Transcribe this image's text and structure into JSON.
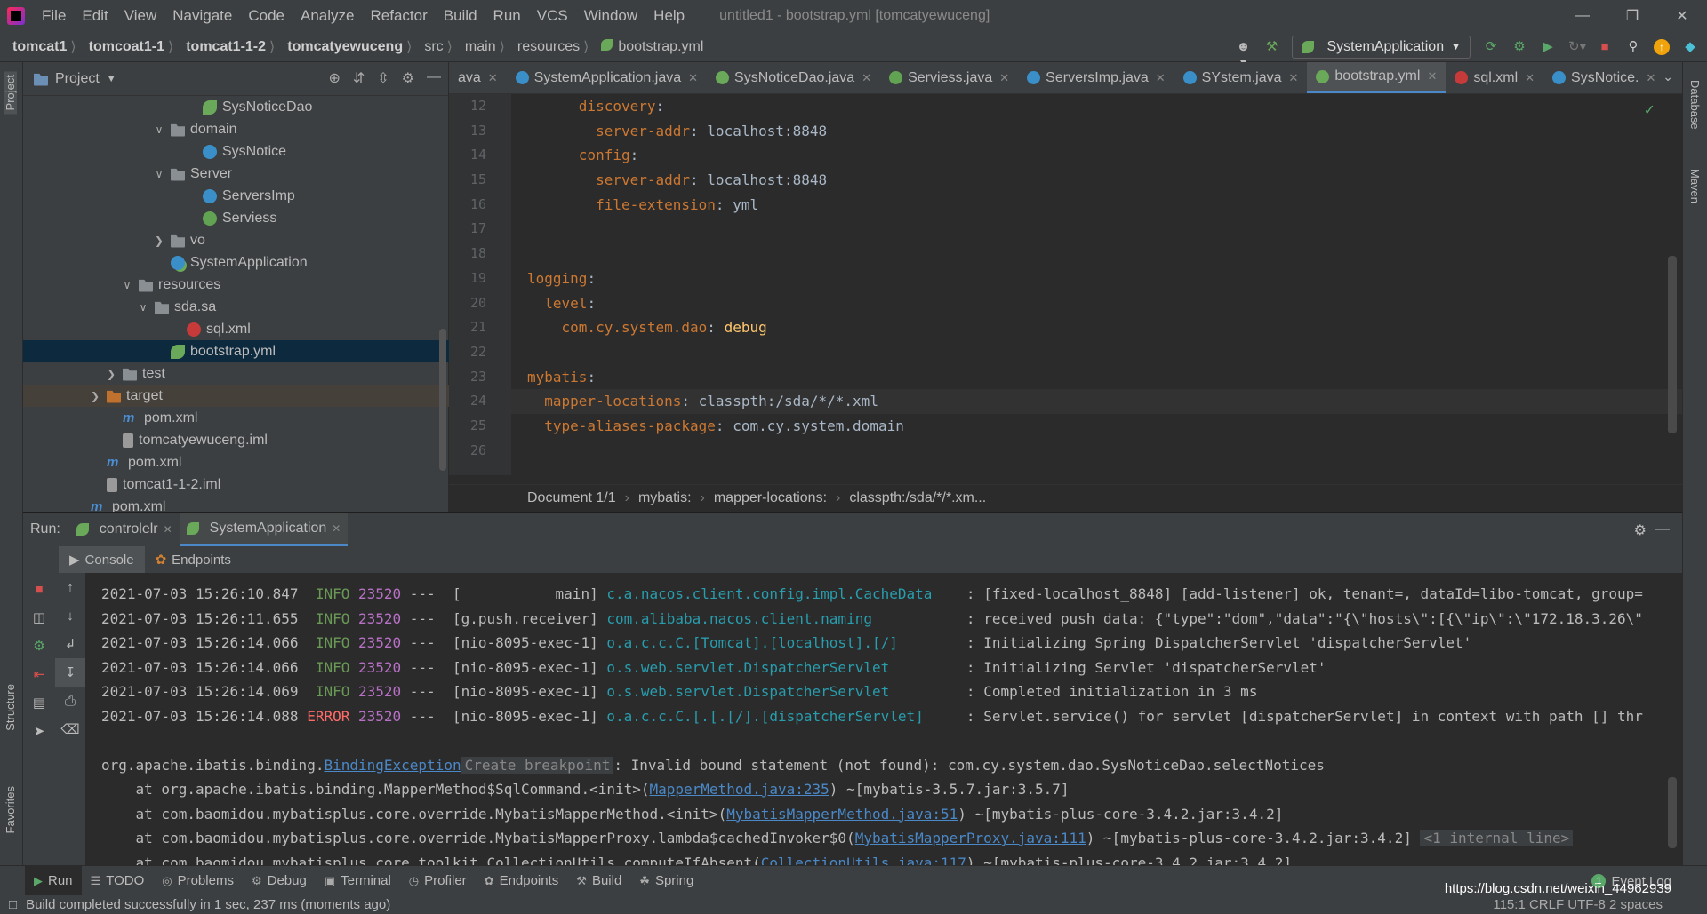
{
  "menubar": {
    "items": [
      "File",
      "Edit",
      "View",
      "Navigate",
      "Code",
      "Analyze",
      "Refactor",
      "Build",
      "Run",
      "VCS",
      "Window",
      "Help"
    ],
    "window_title": "untitled1 - bootstrap.yml [tomcatyewuceng]"
  },
  "breadcrumbs": [
    "tomcat1",
    "tomcoat1-1",
    "tomcat1-1-2",
    "tomcatyewuceng",
    "src",
    "main",
    "resources",
    "bootstrap.yml"
  ],
  "run_config": "SystemApplication",
  "project_panel": {
    "title": "Project",
    "tree": [
      {
        "label": "SysNoticeDao",
        "icon": "spring-icon",
        "indent": 10,
        "arrow": ""
      },
      {
        "label": "domain",
        "icon": "folder-icon",
        "indent": 8,
        "arrow": "v"
      },
      {
        "label": "SysNotice",
        "icon": "class-icon",
        "indent": 10,
        "arrow": ""
      },
      {
        "label": "Server",
        "icon": "folder-icon",
        "indent": 8,
        "arrow": "v"
      },
      {
        "label": "ServersImp",
        "icon": "class-icon",
        "indent": 10,
        "arrow": ""
      },
      {
        "label": "Serviess",
        "icon": "interface-icon",
        "indent": 10,
        "arrow": ""
      },
      {
        "label": "vo",
        "icon": "folder-icon",
        "indent": 8,
        "arrow": ">"
      },
      {
        "label": "SystemApplication",
        "icon": "spring-app-icon",
        "indent": 8,
        "arrow": ""
      },
      {
        "label": "resources",
        "icon": "folder-icon",
        "indent": 6,
        "arrow": "v"
      },
      {
        "label": "sda.sa",
        "icon": "folder-icon",
        "indent": 7,
        "arrow": "v"
      },
      {
        "label": "sql.xml",
        "icon": "xml-icon",
        "indent": 9,
        "arrow": ""
      },
      {
        "label": "bootstrap.yml",
        "icon": "spring-icon",
        "indent": 8,
        "arrow": "",
        "selected": true
      },
      {
        "label": "test",
        "icon": "folder-icon",
        "indent": 5,
        "arrow": ">"
      },
      {
        "label": "target",
        "icon": "folder-orange-icon",
        "indent": 4,
        "arrow": ">",
        "target": true
      },
      {
        "label": "pom.xml",
        "icon": "maven-icon",
        "indent": 5,
        "arrow": ""
      },
      {
        "label": "tomcatyewuceng.iml",
        "icon": "iml-icon",
        "indent": 5,
        "arrow": ""
      },
      {
        "label": "pom.xml",
        "icon": "maven-icon",
        "indent": 4,
        "arrow": ""
      },
      {
        "label": "tomcat1-1-2.iml",
        "icon": "iml-icon",
        "indent": 4,
        "arrow": ""
      },
      {
        "label": "pom.xml",
        "icon": "maven-icon",
        "indent": 3,
        "arrow": ""
      }
    ]
  },
  "editor_tabs": [
    {
      "label": "ava",
      "color": "#3a8fc9",
      "active": false,
      "partial": true
    },
    {
      "label": "SystemApplication.java",
      "color": "#3a8fc9",
      "active": false
    },
    {
      "label": "SysNoticeDao.java",
      "color": "#6aa85a",
      "active": false
    },
    {
      "label": "Serviess.java",
      "color": "#61a352",
      "active": false
    },
    {
      "label": "ServersImp.java",
      "color": "#3a8fc9",
      "active": false
    },
    {
      "label": "SYstem.java",
      "color": "#3a8fc9",
      "active": false
    },
    {
      "label": "bootstrap.yml",
      "color": "#6aa85a",
      "active": true
    },
    {
      "label": "sql.xml",
      "color": "#c63a3a",
      "active": false
    },
    {
      "label": "SysNotice.",
      "color": "#3a8fc9",
      "active": false
    }
  ],
  "code": {
    "line_numbers": [
      "12",
      "13",
      "14",
      "15",
      "16",
      "17",
      "18",
      "19",
      "20",
      "21",
      "22",
      "23",
      "24",
      "25",
      "26"
    ],
    "lines": [
      {
        "indent": "      ",
        "key": "discovery",
        "sep": ":",
        "val": ""
      },
      {
        "indent": "        ",
        "key": "server-addr",
        "sep": ": ",
        "val": "localhost:8848"
      },
      {
        "indent": "      ",
        "key": "config",
        "sep": ":",
        "val": ""
      },
      {
        "indent": "        ",
        "key": "server-addr",
        "sep": ": ",
        "val": "localhost:8848"
      },
      {
        "indent": "        ",
        "key": "file-extension",
        "sep": ": ",
        "val": "yml"
      },
      {
        "indent": "",
        "key": "",
        "sep": "",
        "val": ""
      },
      {
        "indent": "",
        "key": "",
        "sep": "",
        "val": ""
      },
      {
        "indent": "",
        "key": "logging",
        "sep": ":",
        "val": ""
      },
      {
        "indent": "  ",
        "key": "level",
        "sep": ":",
        "val": ""
      },
      {
        "indent": "    ",
        "key": "com.cy.system.dao",
        "sep": ": ",
        "val": "debug",
        "valclass": "g"
      },
      {
        "indent": "",
        "key": "",
        "sep": "",
        "val": ""
      },
      {
        "indent": "",
        "key": "mybatis",
        "sep": ":",
        "val": ""
      },
      {
        "indent": "  ",
        "key": "mapper-locations",
        "sep": ": ",
        "val": "classpth:/sda/*/*.xml",
        "current": true
      },
      {
        "indent": "  ",
        "key": "type-aliases-package",
        "sep": ": ",
        "val": "com.cy.system.domain"
      },
      {
        "indent": "",
        "key": "",
        "sep": "",
        "val": ""
      }
    ]
  },
  "editor_status": {
    "doc": "Document 1/1",
    "path": [
      "mybatis:",
      "mapper-locations:",
      "classpth:/sda/*/*.xm..."
    ]
  },
  "run_panel": {
    "label": "Run:",
    "tabs": [
      {
        "label": "controlelr",
        "active": false
      },
      {
        "label": "SystemApplication",
        "active": true
      }
    ],
    "subtabs": [
      "Console",
      "Endpoints"
    ],
    "console_lines": [
      {
        "ts": "2021-07-03 15:26:10.847",
        "lvl": "INFO",
        "pid": "23520",
        "thread": "---  [           main]",
        "cat": "c.a.nacos.client.config.impl.CacheData   ",
        "msg": ": [fixed-localhost_8848] [add-listener] ok, tenant=, dataId=libo-tomcat, group="
      },
      {
        "ts": "2021-07-03 15:26:11.655",
        "lvl": "INFO",
        "pid": "23520",
        "thread": "---  [g.push.receiver]",
        "cat": "com.alibaba.nacos.client.naming          ",
        "msg": ": received push data: {\"type\":\"dom\",\"data\":\"{\\\"hosts\\\":[{\\\"ip\\\":\\\"172.18.3.26\\\""
      },
      {
        "ts": "2021-07-03 15:26:14.066",
        "lvl": "INFO",
        "pid": "23520",
        "thread": "---  [nio-8095-exec-1]",
        "cat": "o.a.c.c.C.[Tomcat].[localhost].[/]       ",
        "msg": ": Initializing Spring DispatcherServlet 'dispatcherServlet'"
      },
      {
        "ts": "2021-07-03 15:26:14.066",
        "lvl": "INFO",
        "pid": "23520",
        "thread": "---  [nio-8095-exec-1]",
        "cat": "o.s.web.servlet.DispatcherServlet        ",
        "msg": ": Initializing Servlet 'dispatcherServlet'"
      },
      {
        "ts": "2021-07-03 15:26:14.069",
        "lvl": "INFO",
        "pid": "23520",
        "thread": "---  [nio-8095-exec-1]",
        "cat": "o.s.web.servlet.DispatcherServlet        ",
        "msg": ": Completed initialization in 3 ms"
      },
      {
        "ts": "2021-07-03 15:26:14.088",
        "lvl": "ERROR",
        "pid": "23520",
        "thread": "---  [nio-8095-exec-1]",
        "cat": "o.a.c.c.C.[.[.[/].[dispatcherServlet]    ",
        "msg": ": Servlet.service() for servlet [dispatcherServlet] in context with path [] thr"
      }
    ],
    "exception": {
      "prefix": "org.apache.ibatis.binding.",
      "link": "BindingException",
      "hint": "Create breakpoint",
      "msg": ": Invalid bound statement (not found): com.cy.system.dao.SysNoticeDao.selectNotices"
    },
    "stack": [
      {
        "pre": "    at org.apache.ibatis.binding.MapperMethod$SqlCommand.<init>(",
        "link": "MapperMethod.java:235",
        "post": ") ~[mybatis-3.5.7.jar:3.5.7]",
        "hint": ""
      },
      {
        "pre": "    at com.baomidou.mybatisplus.core.override.MybatisMapperMethod.<init>(",
        "link": "MybatisMapperMethod.java:51",
        "post": ") ~[mybatis-plus-core-3.4.2.jar:3.4.2]",
        "hint": ""
      },
      {
        "pre": "    at com.baomidou.mybatisplus.core.override.MybatisMapperProxy.lambda$cachedInvoker$0(",
        "link": "MybatisMapperProxy.java:111",
        "post": ") ~[mybatis-plus-core-3.4.2.jar:3.4.2] ",
        "hint": "<1 internal line>"
      },
      {
        "pre": "    at com.baomidou.mybatisplus.core.toolkit.CollectionUtils.computeIfAbsent(",
        "link": "CollectionUtils.java:117",
        "post": ") ~[mybatis-plus-core-3.4.2.jar:3.4.2]",
        "hint": ""
      }
    ]
  },
  "bottom_tabs": [
    "Run",
    "TODO",
    "Problems",
    "Debug",
    "Terminal",
    "Profiler",
    "Endpoints",
    "Build",
    "Spring"
  ],
  "event_log": "Event Log",
  "status": {
    "message": "Build completed successfully in 1 sec, 237 ms (moments ago)",
    "right": "115:1  CRLF  UTF-8  2 spaces",
    "watermark": "https://blog.csdn.net/weixin_44962939"
  },
  "side_labels": {
    "project": "Project",
    "structure": "Structure",
    "favorites": "Favorites",
    "database": "Database",
    "maven": "Maven"
  }
}
